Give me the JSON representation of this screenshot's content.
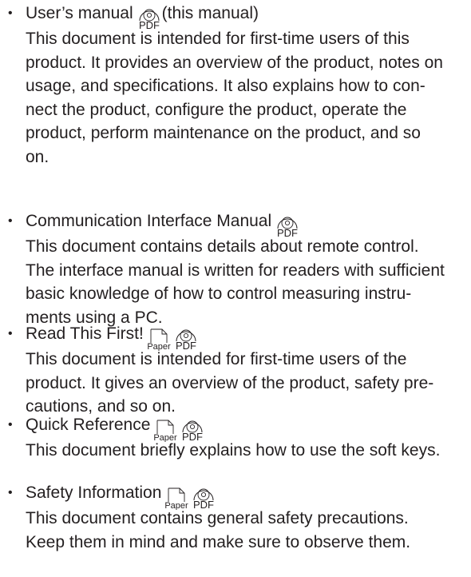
{
  "items": [
    {
      "title": "User’s manual",
      "title_suffix": "(this manual)",
      "icons": [
        "pdf-icon"
      ],
      "lines": [
        "This document is intended for first-time users of this",
        "product. It provides an overview of the product, notes on",
        "usage, and specifications. It also explains how to con-",
        "nect the product, configure the product, operate the",
        "product, perform maintenance on the product, and so",
        "on."
      ]
    },
    {
      "title": "Communication Interface Manual",
      "icons": [
        "pdf-icon"
      ],
      "lines": [
        "This document contains details about remote control.",
        "The interface manual is written for readers with sufficient",
        "basic knowledge of how to control measuring instru-",
        "ments using a PC."
      ]
    },
    {
      "title": "Read This First!",
      "icons": [
        "paper-icon",
        "pdf-icon"
      ],
      "lines": [
        "This document is intended for first-time users of the",
        "product. It gives an overview of the product, safety pre-",
        "cautions, and so on."
      ]
    },
    {
      "title": "Quick Reference",
      "icons": [
        "paper-icon",
        "pdf-icon"
      ],
      "lines": [
        "This document briefly explains how to use the soft keys."
      ]
    },
    {
      "title": "Safety Information",
      "icons": [
        "paper-icon",
        "pdf-icon"
      ],
      "lines": [
        "This document contains general safety precautions.",
        "Keep them in mind and make sure to observe them."
      ]
    }
  ],
  "icon_labels": {
    "paper": "Paper",
    "pdf": "PDF"
  },
  "bullet_char": "•"
}
